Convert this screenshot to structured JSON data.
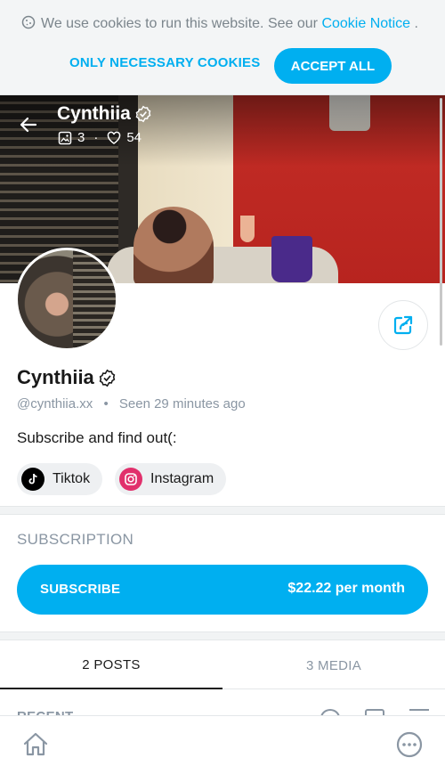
{
  "cookie": {
    "message": "We use cookies to run this website. See our",
    "link": "Cookie Notice",
    "suffix": ".",
    "necessary_label": "ONLY NECESSARY COOKIES",
    "accept_label": "ACCEPT ALL"
  },
  "header": {
    "name": "Cynthiia",
    "photos_count": "3",
    "likes_count": "54"
  },
  "profile": {
    "name": "Cynthiia",
    "handle": "@cynthiia.xx",
    "seen_label": "Seen",
    "seen_time": "29 minutes ago",
    "bio": "Subscribe and find out(:",
    "socials": [
      {
        "label": "Tiktok"
      },
      {
        "label": "Instagram"
      }
    ]
  },
  "subscription": {
    "title": "SUBSCRIPTION",
    "button_label": "SUBSCRIBE",
    "price": "$22.22 per month"
  },
  "tabs": [
    {
      "label": "2 POSTS",
      "active": true
    },
    {
      "label": "3 MEDIA",
      "active": false
    }
  ],
  "recent": {
    "label": "RECENT"
  },
  "colors": {
    "accent": "#00aff0",
    "muted": "#8a96a3",
    "tiktok": "#000000",
    "instagram": "#e1306c"
  },
  "icons": [
    "cookie-icon",
    "back-arrow-icon",
    "verified-icon",
    "image-icon",
    "heart-icon",
    "share-icon",
    "tiktok-icon",
    "instagram-icon",
    "home-icon",
    "more-icon"
  ]
}
